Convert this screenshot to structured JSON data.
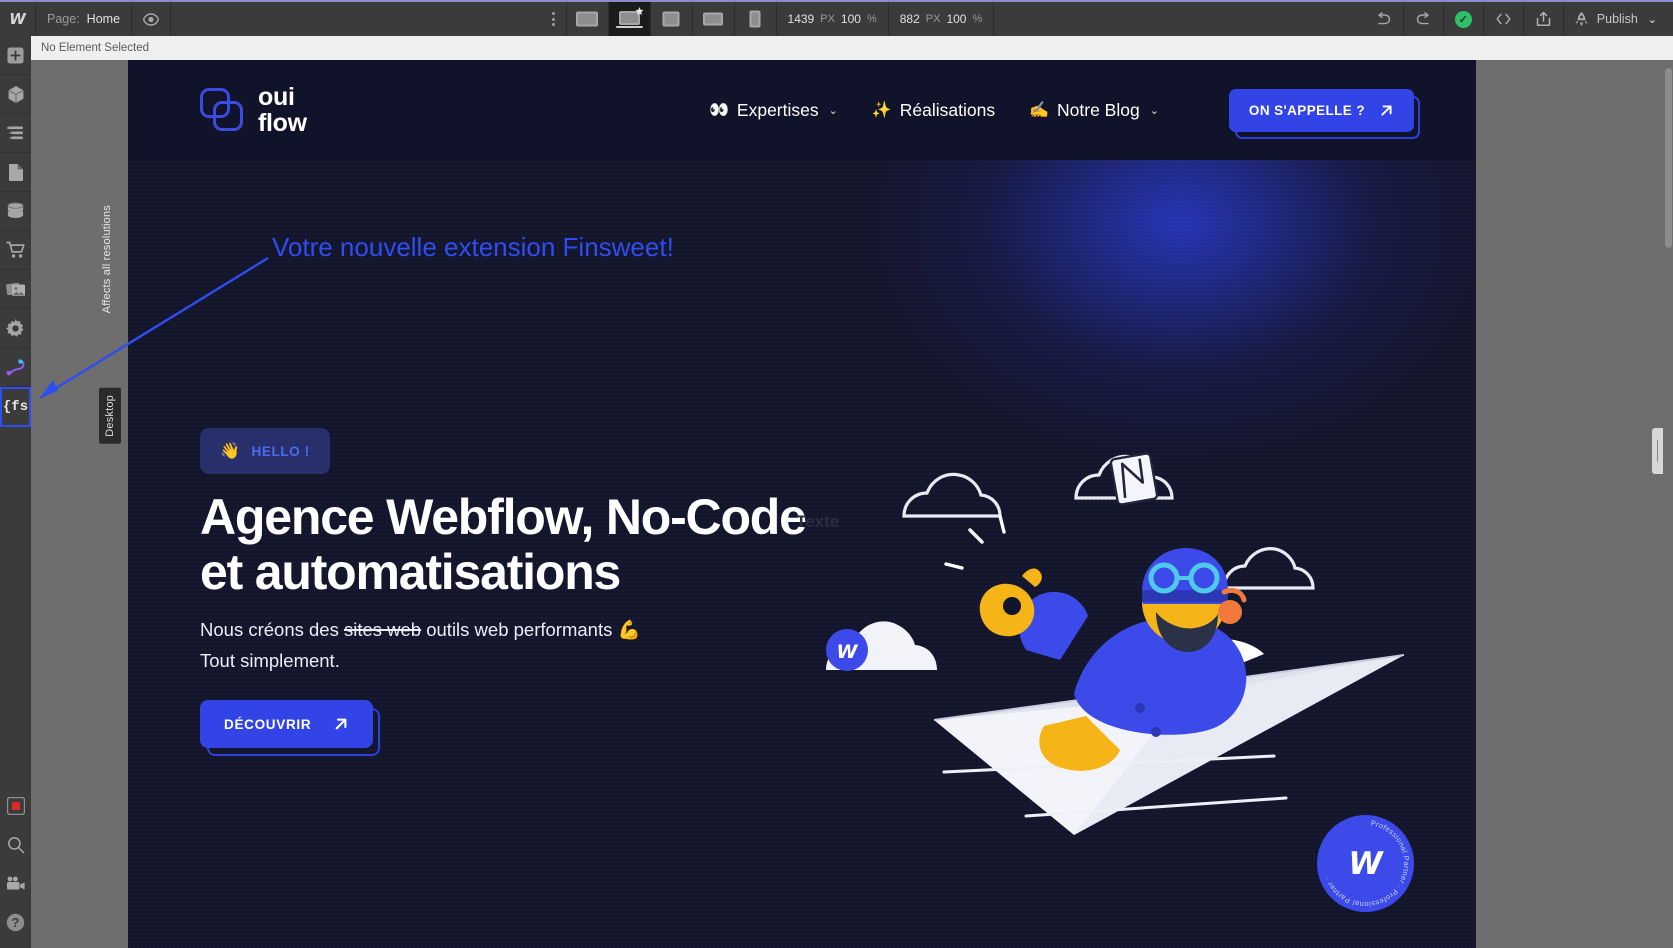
{
  "app": {
    "name": "Webflow Designer",
    "logo_icon": "webflow-logo-icon"
  },
  "topbar": {
    "page_label": "Page:",
    "page_name": "Home",
    "preview_icon": "eye-icon",
    "kebab_icon": "more-options-icon",
    "devices": [
      {
        "name": "desktop",
        "icon": "monitor-icon",
        "active": false
      },
      {
        "name": "laptop",
        "icon": "laptop-star-icon",
        "active": true
      },
      {
        "name": "tablet-portrait",
        "icon": "tablet-icon",
        "active": false
      },
      {
        "name": "tablet-landscape",
        "icon": "tablet-landscape-icon",
        "active": false
      },
      {
        "name": "mobile",
        "icon": "phone-icon",
        "active": false
      }
    ],
    "width_value": "1439",
    "width_unit": "PX",
    "width_zoom": "100",
    "width_zoom_unit": "%",
    "height_value": "882",
    "height_unit": "PX",
    "height_zoom": "100",
    "height_zoom_unit": "%",
    "undo_icon": "undo-icon",
    "redo_icon": "redo-icon",
    "saved_icon": "checkmark-saved-icon",
    "code_icon": "code-brackets-icon",
    "export_icon": "export-share-icon",
    "rocket_icon": "rocket-icon",
    "publish_label": "Publish",
    "publish_caret": "chevron-down-icon"
  },
  "status_strip": {
    "text": "No Element Selected"
  },
  "left_rail": {
    "items": [
      {
        "name": "add-elements",
        "icon": "plus-icon"
      },
      {
        "name": "components",
        "icon": "cube-icon"
      },
      {
        "name": "navigator",
        "icon": "layers-icon"
      },
      {
        "name": "pages",
        "icon": "page-icon"
      },
      {
        "name": "cms-collections",
        "icon": "database-icon"
      },
      {
        "name": "ecommerce",
        "icon": "shopping-cart-icon"
      },
      {
        "name": "assets",
        "icon": "images-icon"
      },
      {
        "name": "settings",
        "icon": "gear-icon"
      },
      {
        "name": "audit",
        "icon": "audit-swirl-icon"
      },
      {
        "name": "finsweet-extension",
        "icon": "fs-braces-icon",
        "active": true
      }
    ],
    "bottom_items": [
      {
        "name": "video-record",
        "icon": "record-square-icon"
      },
      {
        "name": "search",
        "icon": "search-magnifier-icon"
      },
      {
        "name": "video-tutorials",
        "icon": "video-camera-icon"
      },
      {
        "name": "help",
        "icon": "question-mark-icon"
      }
    ]
  },
  "canvas": {
    "breakpoint_hint": "Affects all resolutions",
    "breakpoint_label": "Desktop"
  },
  "annotation": {
    "text": "Votre nouvelle extension Finsweet!",
    "color": "#2f4df0",
    "arrow_icon": "arrow-pointer-icon"
  },
  "site": {
    "nav": {
      "brand_line1": "oui",
      "brand_line2": "flow",
      "brand_icon": "ouiflow-logo-icon",
      "links": [
        {
          "emoji": "👀",
          "label": "Expertises",
          "has_caret": true,
          "icon": "eyes-emoji"
        },
        {
          "emoji": "✨",
          "label": "Réalisations",
          "has_caret": false,
          "icon": "sparkles-emoji"
        },
        {
          "emoji": "✍️",
          "label": "Notre Blog",
          "has_caret": true,
          "icon": "writing-hand-emoji"
        }
      ],
      "cta_label": "ON S'APPELLE ?",
      "cta_icon": "arrow-up-right-icon"
    },
    "hero": {
      "badge_emoji": "👋",
      "badge_label": "HELLO !",
      "title_line1": "Agence Webflow, No-Code",
      "title_line2": "et automatisations",
      "sub_prefix": "Nous créons des ",
      "sub_strike": "sites web",
      "sub_suffix": " outils web performants 💪",
      "sub_line2": "Tout simplement.",
      "button_label": "DÉCOUVRIR",
      "button_icon": "arrow-up-right-icon",
      "ghost_text": "Texte",
      "illustration_icon": "paper-plane-pilot-illustration"
    },
    "partner_badge": {
      "letter": "W",
      "ring_text": "Professional Partner · Professional Partner ·",
      "icon": "webflow-partner-badge-icon"
    }
  },
  "colors": {
    "accent_blue": "#3344e6",
    "annotation_blue": "#2f4df0",
    "site_bg": "#13152c",
    "nav_bg": "#11132a",
    "chrome_bg": "#3b3b3b",
    "canvas_bg": "#6e6e6e",
    "saved_green": "#2fc06a"
  }
}
